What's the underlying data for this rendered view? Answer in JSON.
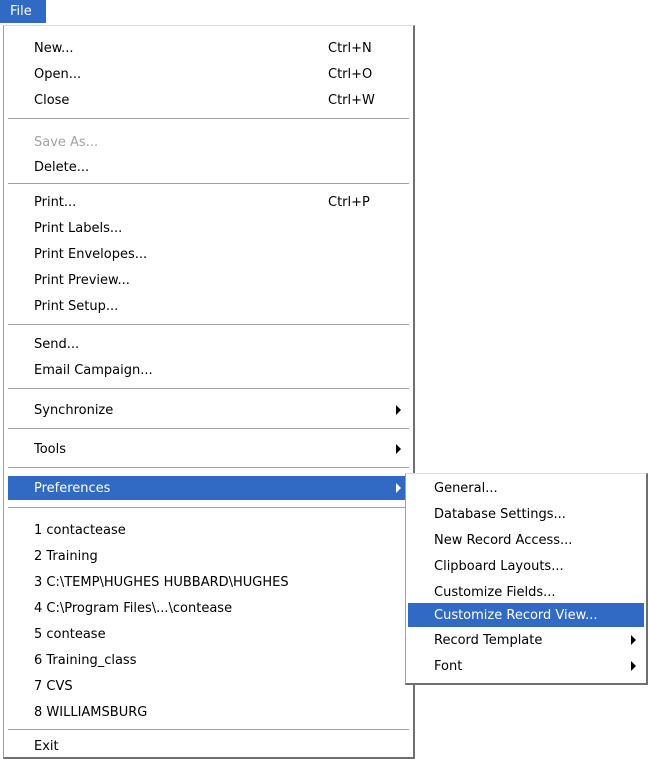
{
  "menubar": {
    "file_label": "File"
  },
  "menu": {
    "new": {
      "label": "New...",
      "shortcut": "Ctrl+N"
    },
    "open": {
      "label": "Open...",
      "shortcut": "Ctrl+O"
    },
    "close": {
      "label": "Close",
      "shortcut": "Ctrl+W"
    },
    "save_as": {
      "label": "Save As..."
    },
    "delete": {
      "label": "Delete..."
    },
    "print": {
      "label": "Print...",
      "shortcut": "Ctrl+P"
    },
    "print_labels": {
      "label": "Print Labels..."
    },
    "print_envelopes": {
      "label": "Print Envelopes..."
    },
    "print_preview": {
      "label": "Print Preview..."
    },
    "print_setup": {
      "label": "Print Setup..."
    },
    "send": {
      "label": "Send..."
    },
    "email_campaign": {
      "label": "Email Campaign..."
    },
    "synchronize": {
      "label": "Synchronize"
    },
    "tools": {
      "label": "Tools"
    },
    "preferences": {
      "label": "Preferences"
    },
    "recent": [
      "1 contactease",
      "2 Training",
      "3 C:\\TEMP\\HUGHES HUBBARD\\HUGHES",
      "4 C:\\Program Files\\...\\contease",
      "5 contease",
      "6 Training_class",
      "7 CVS",
      "8 WILLIAMSBURG"
    ],
    "exit": {
      "label": "Exit"
    }
  },
  "preferences_submenu": {
    "general": "General...",
    "database_settings": "Database Settings...",
    "new_record_access": "New Record Access...",
    "clipboard_layouts": "Clipboard Layouts...",
    "customize_fields": "Customize Fields...",
    "customize_record_view": "Customize Record View...",
    "record_template": "Record Template",
    "font": "Font"
  }
}
